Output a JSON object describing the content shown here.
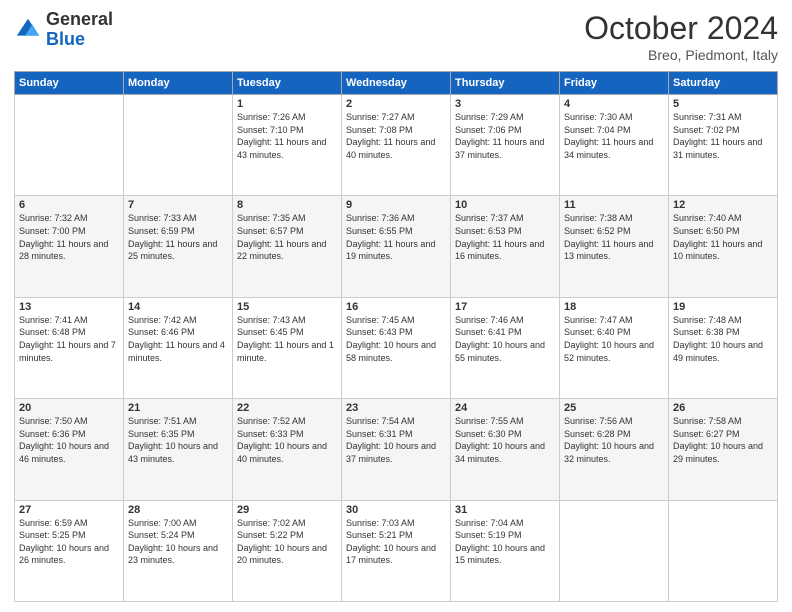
{
  "logo": {
    "general": "General",
    "blue": "Blue"
  },
  "header": {
    "month": "October 2024",
    "location": "Breo, Piedmont, Italy"
  },
  "weekdays": [
    "Sunday",
    "Monday",
    "Tuesday",
    "Wednesday",
    "Thursday",
    "Friday",
    "Saturday"
  ],
  "weeks": [
    [
      {
        "day": null,
        "sunrise": null,
        "sunset": null,
        "daylight": null
      },
      {
        "day": null,
        "sunrise": null,
        "sunset": null,
        "daylight": null
      },
      {
        "day": "1",
        "sunrise": "Sunrise: 7:26 AM",
        "sunset": "Sunset: 7:10 PM",
        "daylight": "Daylight: 11 hours and 43 minutes."
      },
      {
        "day": "2",
        "sunrise": "Sunrise: 7:27 AM",
        "sunset": "Sunset: 7:08 PM",
        "daylight": "Daylight: 11 hours and 40 minutes."
      },
      {
        "day": "3",
        "sunrise": "Sunrise: 7:29 AM",
        "sunset": "Sunset: 7:06 PM",
        "daylight": "Daylight: 11 hours and 37 minutes."
      },
      {
        "day": "4",
        "sunrise": "Sunrise: 7:30 AM",
        "sunset": "Sunset: 7:04 PM",
        "daylight": "Daylight: 11 hours and 34 minutes."
      },
      {
        "day": "5",
        "sunrise": "Sunrise: 7:31 AM",
        "sunset": "Sunset: 7:02 PM",
        "daylight": "Daylight: 11 hours and 31 minutes."
      }
    ],
    [
      {
        "day": "6",
        "sunrise": "Sunrise: 7:32 AM",
        "sunset": "Sunset: 7:00 PM",
        "daylight": "Daylight: 11 hours and 28 minutes."
      },
      {
        "day": "7",
        "sunrise": "Sunrise: 7:33 AM",
        "sunset": "Sunset: 6:59 PM",
        "daylight": "Daylight: 11 hours and 25 minutes."
      },
      {
        "day": "8",
        "sunrise": "Sunrise: 7:35 AM",
        "sunset": "Sunset: 6:57 PM",
        "daylight": "Daylight: 11 hours and 22 minutes."
      },
      {
        "day": "9",
        "sunrise": "Sunrise: 7:36 AM",
        "sunset": "Sunset: 6:55 PM",
        "daylight": "Daylight: 11 hours and 19 minutes."
      },
      {
        "day": "10",
        "sunrise": "Sunrise: 7:37 AM",
        "sunset": "Sunset: 6:53 PM",
        "daylight": "Daylight: 11 hours and 16 minutes."
      },
      {
        "day": "11",
        "sunrise": "Sunrise: 7:38 AM",
        "sunset": "Sunset: 6:52 PM",
        "daylight": "Daylight: 11 hours and 13 minutes."
      },
      {
        "day": "12",
        "sunrise": "Sunrise: 7:40 AM",
        "sunset": "Sunset: 6:50 PM",
        "daylight": "Daylight: 11 hours and 10 minutes."
      }
    ],
    [
      {
        "day": "13",
        "sunrise": "Sunrise: 7:41 AM",
        "sunset": "Sunset: 6:48 PM",
        "daylight": "Daylight: 11 hours and 7 minutes."
      },
      {
        "day": "14",
        "sunrise": "Sunrise: 7:42 AM",
        "sunset": "Sunset: 6:46 PM",
        "daylight": "Daylight: 11 hours and 4 minutes."
      },
      {
        "day": "15",
        "sunrise": "Sunrise: 7:43 AM",
        "sunset": "Sunset: 6:45 PM",
        "daylight": "Daylight: 11 hours and 1 minute."
      },
      {
        "day": "16",
        "sunrise": "Sunrise: 7:45 AM",
        "sunset": "Sunset: 6:43 PM",
        "daylight": "Daylight: 10 hours and 58 minutes."
      },
      {
        "day": "17",
        "sunrise": "Sunrise: 7:46 AM",
        "sunset": "Sunset: 6:41 PM",
        "daylight": "Daylight: 10 hours and 55 minutes."
      },
      {
        "day": "18",
        "sunrise": "Sunrise: 7:47 AM",
        "sunset": "Sunset: 6:40 PM",
        "daylight": "Daylight: 10 hours and 52 minutes."
      },
      {
        "day": "19",
        "sunrise": "Sunrise: 7:48 AM",
        "sunset": "Sunset: 6:38 PM",
        "daylight": "Daylight: 10 hours and 49 minutes."
      }
    ],
    [
      {
        "day": "20",
        "sunrise": "Sunrise: 7:50 AM",
        "sunset": "Sunset: 6:36 PM",
        "daylight": "Daylight: 10 hours and 46 minutes."
      },
      {
        "day": "21",
        "sunrise": "Sunrise: 7:51 AM",
        "sunset": "Sunset: 6:35 PM",
        "daylight": "Daylight: 10 hours and 43 minutes."
      },
      {
        "day": "22",
        "sunrise": "Sunrise: 7:52 AM",
        "sunset": "Sunset: 6:33 PM",
        "daylight": "Daylight: 10 hours and 40 minutes."
      },
      {
        "day": "23",
        "sunrise": "Sunrise: 7:54 AM",
        "sunset": "Sunset: 6:31 PM",
        "daylight": "Daylight: 10 hours and 37 minutes."
      },
      {
        "day": "24",
        "sunrise": "Sunrise: 7:55 AM",
        "sunset": "Sunset: 6:30 PM",
        "daylight": "Daylight: 10 hours and 34 minutes."
      },
      {
        "day": "25",
        "sunrise": "Sunrise: 7:56 AM",
        "sunset": "Sunset: 6:28 PM",
        "daylight": "Daylight: 10 hours and 32 minutes."
      },
      {
        "day": "26",
        "sunrise": "Sunrise: 7:58 AM",
        "sunset": "Sunset: 6:27 PM",
        "daylight": "Daylight: 10 hours and 29 minutes."
      }
    ],
    [
      {
        "day": "27",
        "sunrise": "Sunrise: 6:59 AM",
        "sunset": "Sunset: 5:25 PM",
        "daylight": "Daylight: 10 hours and 26 minutes."
      },
      {
        "day": "28",
        "sunrise": "Sunrise: 7:00 AM",
        "sunset": "Sunset: 5:24 PM",
        "daylight": "Daylight: 10 hours and 23 minutes."
      },
      {
        "day": "29",
        "sunrise": "Sunrise: 7:02 AM",
        "sunset": "Sunset: 5:22 PM",
        "daylight": "Daylight: 10 hours and 20 minutes."
      },
      {
        "day": "30",
        "sunrise": "Sunrise: 7:03 AM",
        "sunset": "Sunset: 5:21 PM",
        "daylight": "Daylight: 10 hours and 17 minutes."
      },
      {
        "day": "31",
        "sunrise": "Sunrise: 7:04 AM",
        "sunset": "Sunset: 5:19 PM",
        "daylight": "Daylight: 10 hours and 15 minutes."
      },
      {
        "day": null,
        "sunrise": null,
        "sunset": null,
        "daylight": null
      },
      {
        "day": null,
        "sunrise": null,
        "sunset": null,
        "daylight": null
      }
    ]
  ]
}
